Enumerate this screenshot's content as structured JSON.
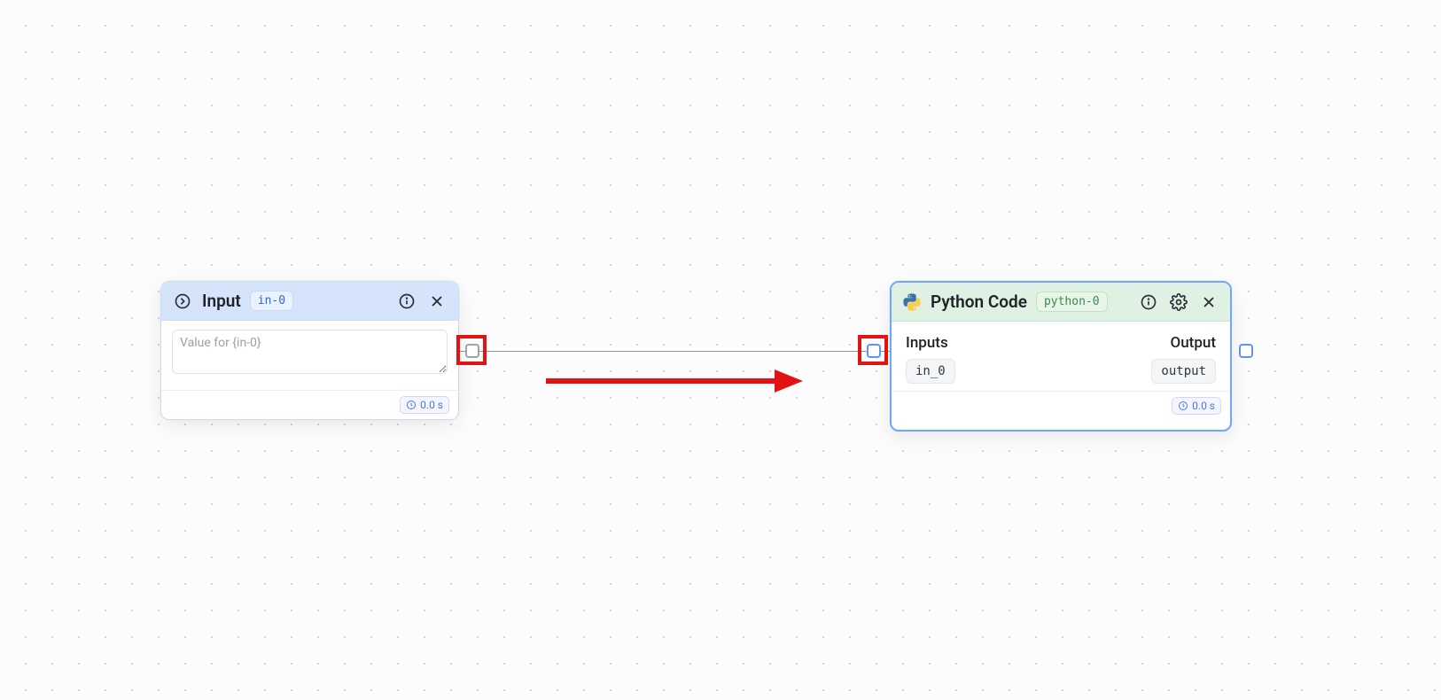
{
  "nodes": {
    "input": {
      "title": "Input",
      "id": "in-0",
      "placeholder": "Value for {in-0}",
      "value": "",
      "timing": "0.0 s"
    },
    "python": {
      "title": "Python Code",
      "id": "python-0",
      "inputs_label": "Inputs",
      "output_label": "Output",
      "input_port": "in_0",
      "output_port": "output",
      "timing": "0.0 s"
    }
  }
}
